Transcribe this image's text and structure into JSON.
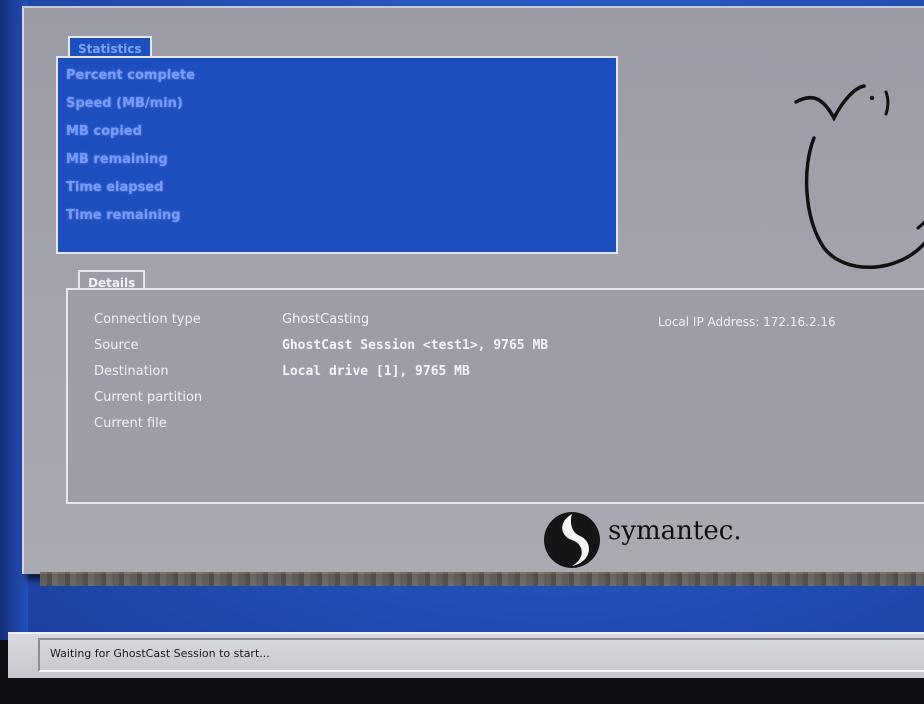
{
  "statistics": {
    "title": "Statistics",
    "labels": [
      "Percent complete",
      "Speed (MB/min)",
      "MB copied",
      "MB remaining",
      "Time elapsed",
      "Time remaining"
    ]
  },
  "details": {
    "title": "Details",
    "rows": [
      {
        "label": "Connection type",
        "value": "GhostCasting"
      },
      {
        "label": "Source",
        "value": "GhostCast Session <test1>, 9765 MB"
      },
      {
        "label": "Destination",
        "value": "Local drive [1], 9765 MB"
      },
      {
        "label": "Current partition",
        "value": ""
      },
      {
        "label": "Current file",
        "value": ""
      }
    ],
    "ip_address": "Local IP Address: 172.16.2.16"
  },
  "brand": {
    "name": "symantec."
  },
  "status_bar": {
    "text": "Waiting for GhostCast Session to start..."
  },
  "colors": {
    "stats_background": "#1e4fbf",
    "window_gray": "#9d9da8",
    "desktop_blue": "#2756c4"
  }
}
